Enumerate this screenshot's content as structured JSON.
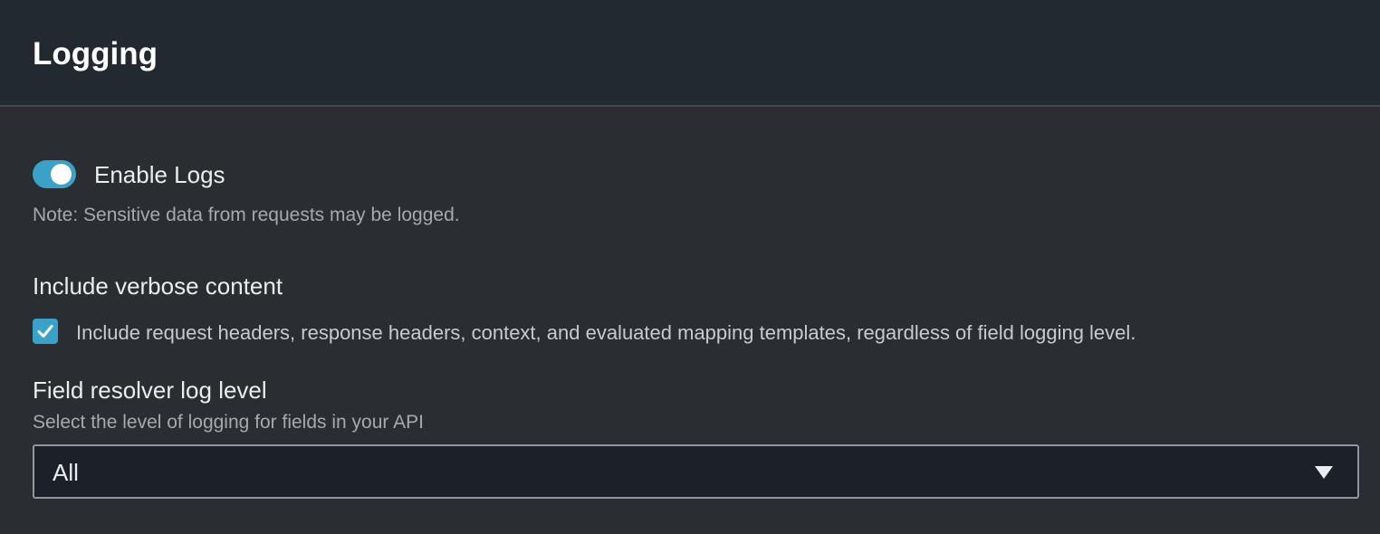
{
  "header": {
    "title": "Logging"
  },
  "enable_logs": {
    "label": "Enable Logs",
    "checked": true,
    "note": "Note: Sensitive data from requests may be logged."
  },
  "verbose": {
    "label": "Include verbose content",
    "checkbox_label": "Include request headers, response headers, context, and evaluated mapping templates, regardless of field logging level.",
    "checked": true
  },
  "field_resolver": {
    "label": "Field resolver log level",
    "description": "Select the level of logging for fields in your API",
    "selected": "All"
  },
  "icons": {
    "toggle": "toggle-switch",
    "checkbox": "checkmark-icon",
    "dropdown": "caret-down-icon"
  },
  "colors": {
    "accent": "#3ba1c7",
    "header_bg": "#232931",
    "panel_bg": "#2a2e33"
  }
}
